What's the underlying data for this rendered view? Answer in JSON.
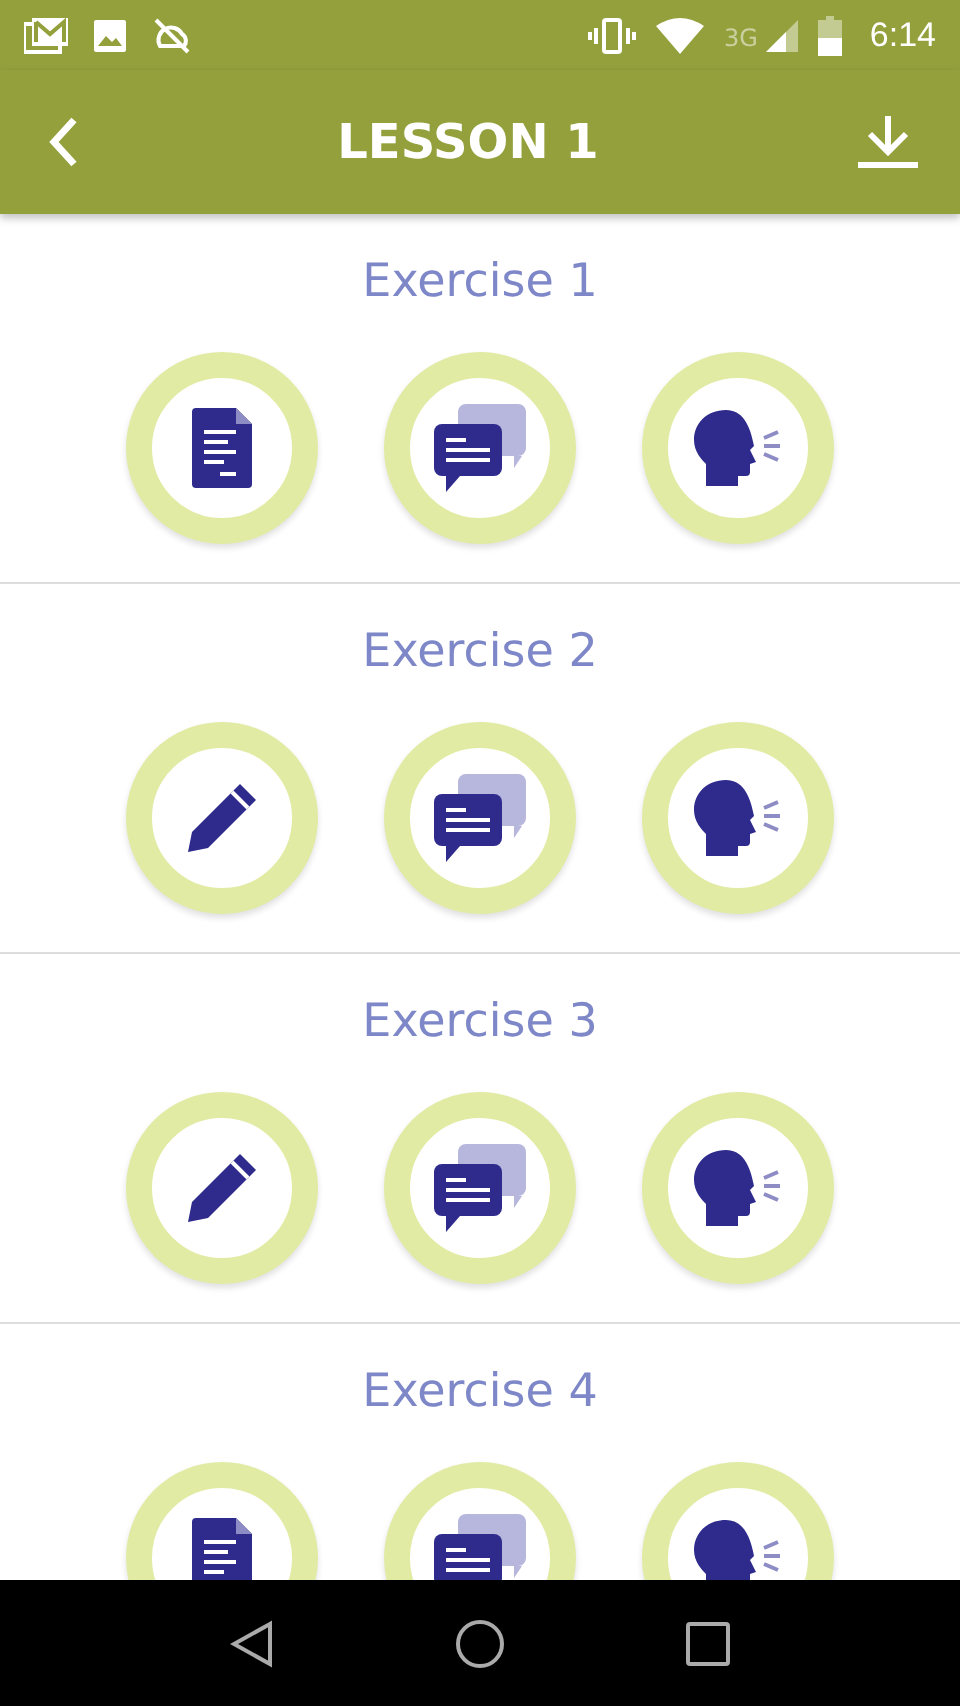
{
  "status_bar": {
    "network": "3G",
    "time": "6:14"
  },
  "app_bar": {
    "title": "LESSON 1"
  },
  "exercises": [
    {
      "title": "Exercise 1",
      "activities": [
        {
          "kind": "document"
        },
        {
          "kind": "chat"
        },
        {
          "kind": "speak"
        }
      ]
    },
    {
      "title": "Exercise 2",
      "activities": [
        {
          "kind": "pencil"
        },
        {
          "kind": "chat"
        },
        {
          "kind": "speak"
        }
      ]
    },
    {
      "title": "Exercise 3",
      "activities": [
        {
          "kind": "pencil"
        },
        {
          "kind": "chat"
        },
        {
          "kind": "speak"
        }
      ]
    },
    {
      "title": "Exercise 4",
      "activities": [
        {
          "kind": "document"
        },
        {
          "kind": "chat"
        },
        {
          "kind": "speak"
        }
      ]
    }
  ]
}
